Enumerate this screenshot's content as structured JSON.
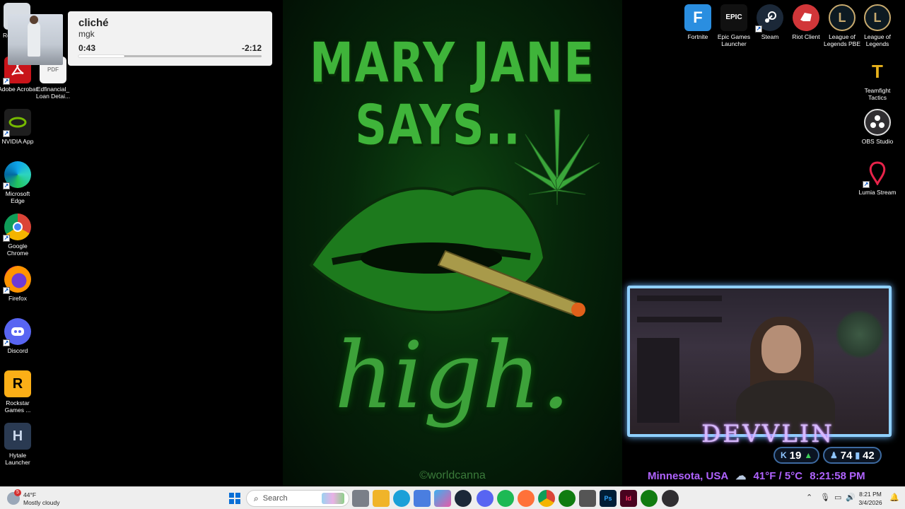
{
  "media": {
    "title": "cliché",
    "artist": "mgk",
    "elapsed": "0:43",
    "remaining": "-2:12",
    "progress_fraction": 0.25
  },
  "wallpaper": {
    "line1": "MARY JANE",
    "line2": "SAYS..",
    "line3": "high.",
    "credit": "©worldcanna"
  },
  "icons_left": [
    {
      "label": "Re",
      "icon": "recycle-bin-icon"
    },
    {
      "label": "Adobe Acrobat",
      "icon": "acrobat-icon"
    },
    {
      "label": "Edfinancial_ Loan Detai...",
      "icon": "pdf-file-icon",
      "badge": "PDF"
    },
    {
      "label": "NVIDIA App",
      "icon": "nvidia-icon"
    },
    {
      "label": "Microsoft Edge",
      "icon": "edge-icon"
    },
    {
      "label": "Google Chrome",
      "icon": "chrome-icon"
    },
    {
      "label": "Firefox",
      "icon": "firefox-icon"
    },
    {
      "label": "Discord",
      "icon": "discord-icon"
    },
    {
      "label": "Rockstar Games ...",
      "icon": "rockstar-icon",
      "glyph": "R"
    },
    {
      "label": "Hytale Launcher",
      "icon": "hytale-icon",
      "glyph": "H"
    }
  ],
  "icons_right": [
    {
      "label": "Fortnite",
      "icon": "fortnite-icon",
      "glyph": "F"
    },
    {
      "label": "Epic Games Launcher",
      "icon": "epic-games-icon",
      "glyph": "EPIC"
    },
    {
      "label": "Steam",
      "icon": "steam-icon"
    },
    {
      "label": "Riot Client",
      "icon": "riot-client-icon"
    },
    {
      "label": "League of Legends PBE",
      "icon": "lol-pbe-icon",
      "glyph": "L"
    },
    {
      "label": "League of Legends",
      "icon": "lol-icon",
      "glyph": "L"
    },
    {
      "label": "Teamfight Tactics",
      "icon": "tft-icon",
      "glyph": "T"
    },
    {
      "label": "OBS Studio",
      "icon": "obs-icon"
    },
    {
      "label": "Lumia Stream",
      "icon": "lumia-icon"
    }
  ],
  "stream": {
    "name": "DEVVLIN",
    "stat1": "19",
    "stat2": "74",
    "stat3": "42",
    "location": "Minnesota, USA",
    "weather": "41°F / 5°C",
    "time": "8:21:58 PM"
  },
  "taskbar": {
    "weather_temp": "44°F",
    "weather_desc": "Mostly cloudy",
    "weather_badge": "5",
    "search_placeholder": "Search",
    "time": "8:21 PM",
    "date": "3/4/2026"
  },
  "colors": {
    "stream_accent": "#b063ff",
    "webcam_border": "#8fd0ff",
    "wallpaper_green": "#3fb43a"
  }
}
